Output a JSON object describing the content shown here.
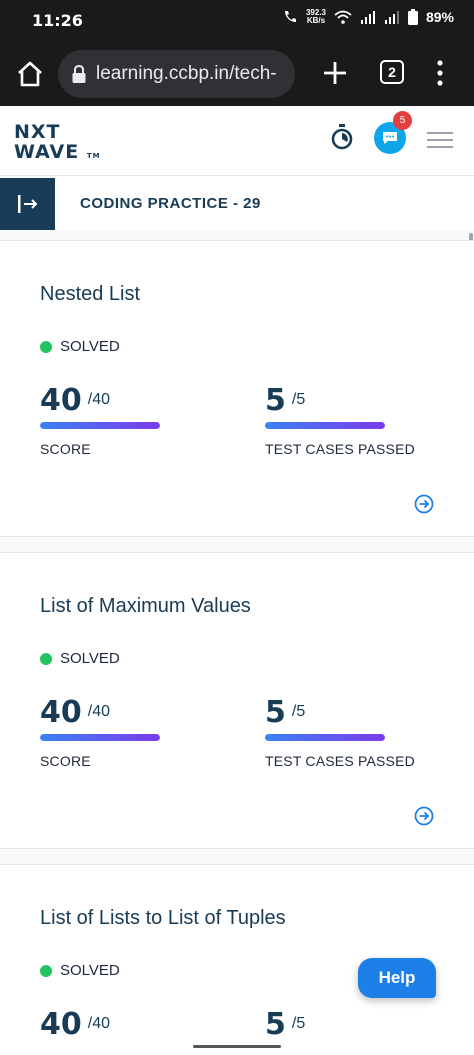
{
  "status_bar": {
    "time": "11:26",
    "net_speed_value": "392.3",
    "net_speed_unit": "KB/s",
    "battery": "89%"
  },
  "browser": {
    "url": "learning.ccbp.in/tech-",
    "tab_count": "2"
  },
  "header": {
    "logo_line1": "NXT",
    "logo_line2": "WAVE",
    "logo_tm": "TM",
    "notification_count": "5"
  },
  "course": {
    "title": "CODING PRACTICE - 29"
  },
  "cards": [
    {
      "title": "Nested List",
      "status": "SOLVED",
      "score": "40",
      "score_total": "/40",
      "score_label": "SCORE",
      "score_progress": 1.0,
      "tests": "5",
      "tests_total": "/5",
      "tests_label": "TEST CASES PASSED",
      "tests_progress": 1.0
    },
    {
      "title": "List of Maximum Values",
      "status": "SOLVED",
      "score": "40",
      "score_total": "/40",
      "score_label": "SCORE",
      "score_progress": 1.0,
      "tests": "5",
      "tests_total": "/5",
      "tests_label": "TEST CASES PASSED",
      "tests_progress": 1.0
    },
    {
      "title": "List of Lists to List of Tuples",
      "status": "SOLVED",
      "score": "40",
      "score_total": "/40",
      "tests": "5",
      "tests_total": "/5"
    }
  ],
  "help": {
    "label": "Help"
  },
  "colors": {
    "brand_navy": "#183b56",
    "solved_green": "#22c55e",
    "progress_start": "#3b82f6",
    "progress_end": "#7c3aed",
    "help_blue": "#1d7fe8"
  }
}
